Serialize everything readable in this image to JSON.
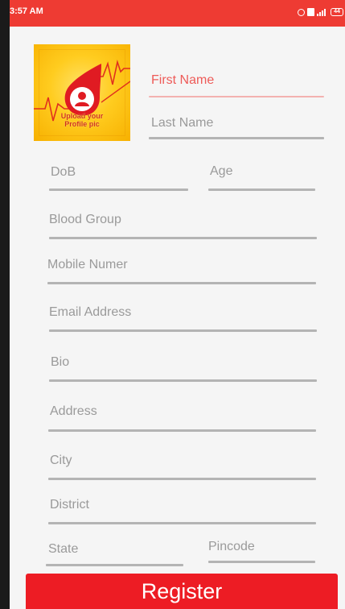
{
  "status_bar": {
    "time": "3:57 AM",
    "battery": "44"
  },
  "avatar": {
    "upload_text_line1": "Upload your",
    "upload_text_line2": "Profile pic"
  },
  "form": {
    "first_name": "First Name",
    "last_name": "Last Name",
    "dob": "DoB",
    "age": "Age",
    "blood_group": "Blood Group",
    "mobile": "Mobile Numer",
    "email": "Email Address",
    "bio": "Bio",
    "address": "Address",
    "city": "City",
    "district": "District",
    "state": "State",
    "pincode": "Pincode"
  },
  "register_label": "Register",
  "colors": {
    "status_bar": "#ee3b33",
    "accent": "#ed1c24",
    "focused_label": "#ee5b58",
    "hint_text": "#9a9a9a"
  }
}
